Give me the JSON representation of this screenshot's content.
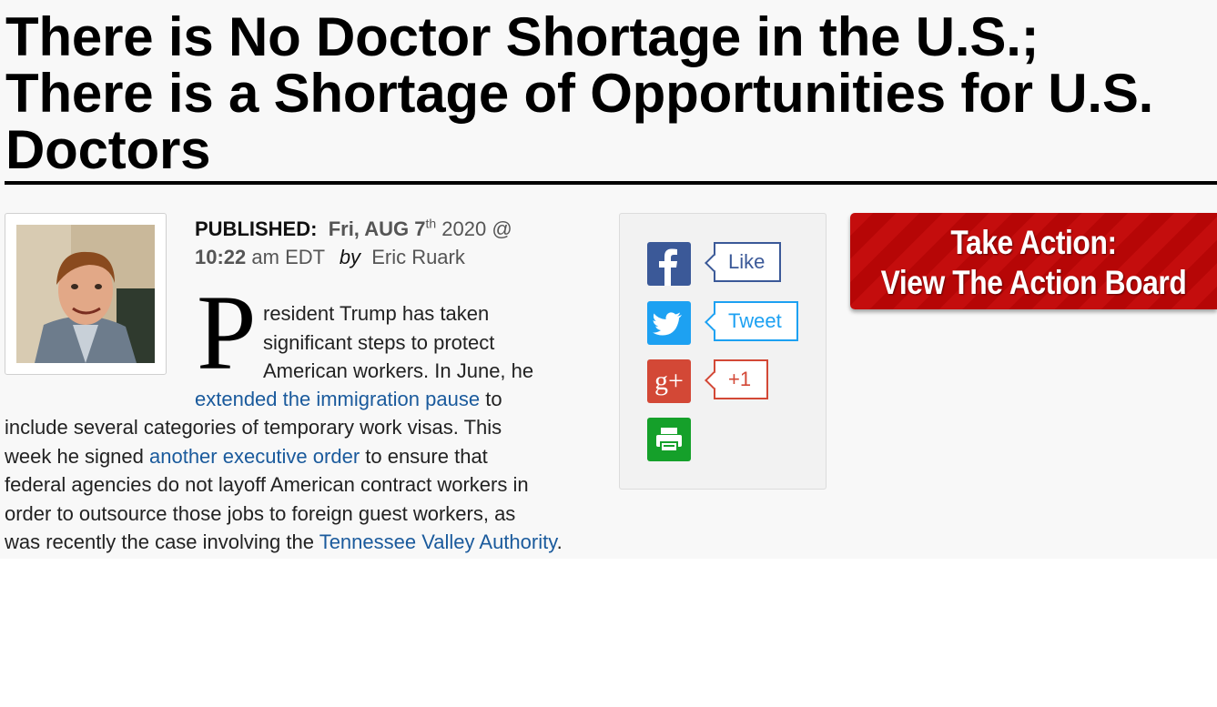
{
  "article": {
    "title_line1": "There is No Doctor Shortage in the U.S.;",
    "title_line2": "There is a Shortage of Opportunities for U.S.",
    "title_line3": "Doctors",
    "published_label": "PUBLISHED",
    "date_day": "Fri, AUG 7",
    "date_suffix": "th",
    "date_year": "2020 @",
    "time": "10:22",
    "time_suffix": "am EDT",
    "by_label": "by",
    "author": "Eric Ruark",
    "dropcap": "P",
    "para_lines_indented": [
      "resident Trump has taken",
      "significant steps to protect",
      "American workers. In June, he"
    ],
    "link1": "extended the immigration pause",
    "text_after_link1": " to",
    "line5": "include several categories of temporary work visas. This",
    "text_before_link2": "week he signed ",
    "link2": "another executive order",
    "text_after_link2": " to ensure that",
    "line7": "federal agencies do not layoff American contract workers in",
    "line8": "order to outsource those jobs to foreign guest workers, as",
    "text_before_link3": "was recently the case involving the ",
    "link3": "Tennessee Valley Authority",
    "text_after_link3": "."
  },
  "share": {
    "facebook": {
      "icon": "facebook-icon",
      "label": "Like",
      "color": "#3b5998"
    },
    "twitter": {
      "icon": "twitter-icon",
      "label": "Tweet",
      "color": "#1da1f2"
    },
    "googleplus": {
      "icon": "google-plus-icon",
      "glyph": "g+",
      "label": "+1",
      "color": "#d34836"
    },
    "print": {
      "icon": "print-icon",
      "color": "#15a02a"
    }
  },
  "action_banner": {
    "line1": "Take Action:",
    "line2": "View The Action Board"
  }
}
